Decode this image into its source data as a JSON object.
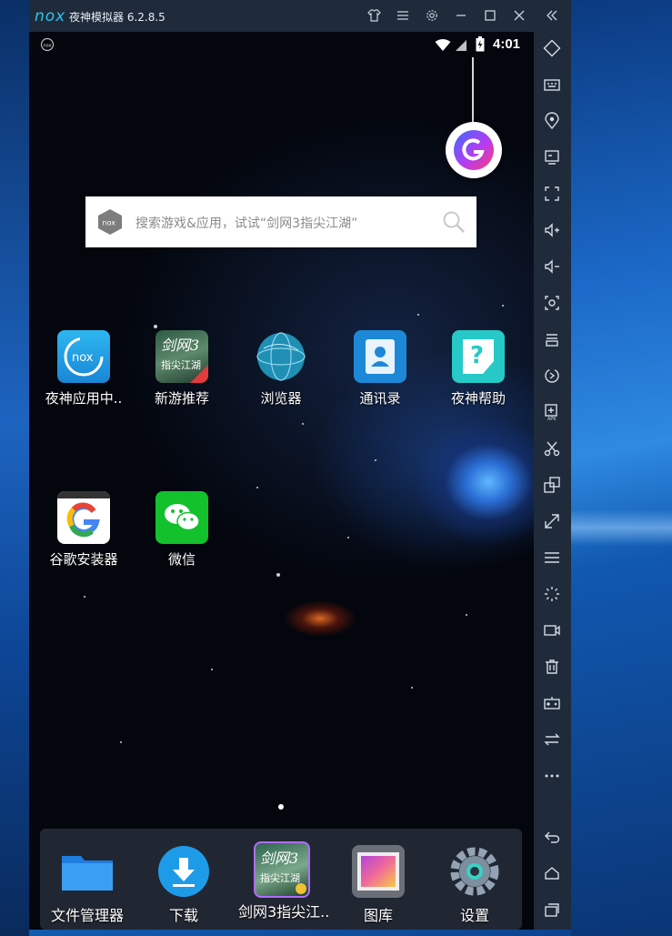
{
  "window": {
    "title": "夜神模拟器 6.2.8.5",
    "logo_text": "nox"
  },
  "status_bar": {
    "time": "4:01"
  },
  "search": {
    "placeholder": "搜索游戏&应用，试试“剑网3指尖江湖”"
  },
  "home_apps": [
    {
      "label": "夜神应用中..",
      "icon": "nox-app-center-icon"
    },
    {
      "label": "新游推荐",
      "icon": "jianwang3-game-icon"
    },
    {
      "label": "浏览器",
      "icon": "browser-globe-icon"
    },
    {
      "label": "通讯录",
      "icon": "contacts-icon"
    },
    {
      "label": "夜神帮助",
      "icon": "nox-help-icon"
    },
    {
      "label": "谷歌安装器",
      "icon": "google-installer-icon"
    },
    {
      "label": "微信",
      "icon": "wechat-icon"
    }
  ],
  "dock_apps": [
    {
      "label": "文件管理器",
      "icon": "folder-icon"
    },
    {
      "label": "下载",
      "icon": "download-icon"
    },
    {
      "label": "剑网3指尖江..",
      "icon": "jianwang3-game-icon"
    },
    {
      "label": "图库",
      "icon": "gallery-icon"
    },
    {
      "label": "设置",
      "icon": "settings-gear-icon"
    }
  ],
  "sidebar_tools": [
    "rotate-icon",
    "keyboard-icon",
    "location-icon",
    "screen-record-icon",
    "fullscreen-icon",
    "volume-up-icon",
    "volume-down-icon",
    "screenshot-icon",
    "multi-instance-icon",
    "shake-icon",
    "add-apk-icon",
    "scissors-icon",
    "multi-window-icon",
    "resize-icon",
    "menu-icon",
    "loading-icon",
    "video-icon",
    "trash-icon",
    "gamepad-icon",
    "sync-icon",
    "more-icon",
    "back-icon",
    "home-icon",
    "recent-apps-icon"
  ],
  "colors": {
    "accent": "#27c6f0",
    "chrome": "#1f2b3a"
  }
}
